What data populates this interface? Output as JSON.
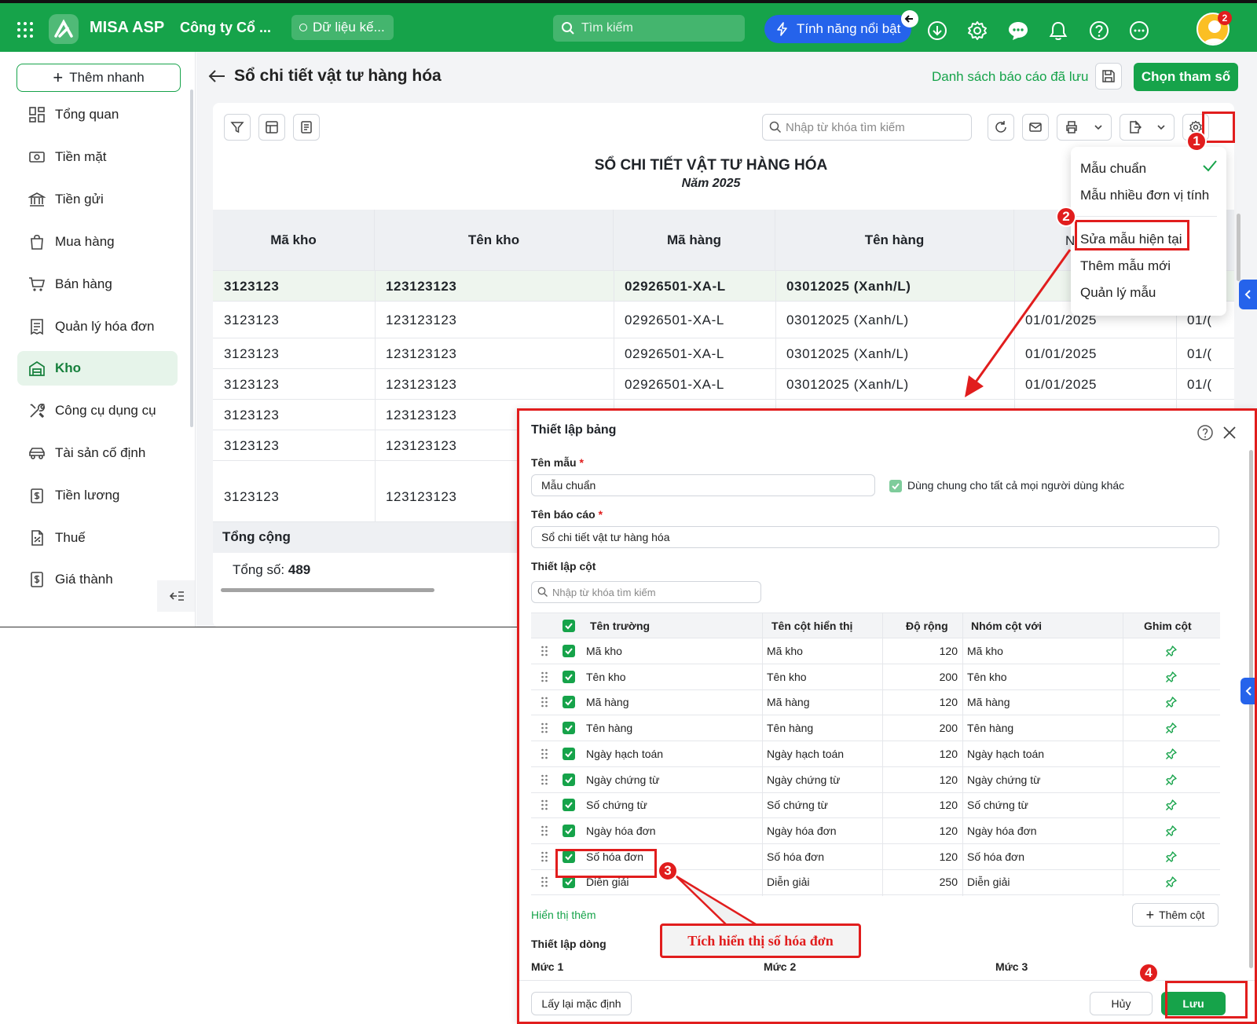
{
  "topbar": {
    "app_name": "MISA ASP",
    "company": "Công ty Cổ ...",
    "data_label": "Dữ liệu kế...",
    "search_placeholder": "Tìm kiếm",
    "feature_label": "Tính năng nổi bật",
    "notif_count": "2"
  },
  "sidebar": {
    "quick_add": "Thêm nhanh",
    "items": [
      {
        "label": "Tổng quan"
      },
      {
        "label": "Tiền mặt"
      },
      {
        "label": "Tiền gửi"
      },
      {
        "label": "Mua hàng"
      },
      {
        "label": "Bán hàng"
      },
      {
        "label": "Quản lý hóa đơn"
      },
      {
        "label": "Kho"
      },
      {
        "label": "Công cụ dụng cụ"
      },
      {
        "label": "Tài sản cố định"
      },
      {
        "label": "Tiền lương"
      },
      {
        "label": "Thuế"
      },
      {
        "label": "Giá thành"
      }
    ]
  },
  "page": {
    "title": "Sổ chi tiết vật tư hàng hóa",
    "saved_reports": "Danh sách báo cáo đã lưu",
    "choose_params": "Chọn tham số",
    "search_placeholder": "Nhập từ khóa tìm kiếm",
    "report_title": "SỔ CHI TIẾT VẬT TƯ HÀNG HÓA",
    "report_year": "Năm 2025"
  },
  "table": {
    "headers": [
      "Mã kho",
      "Tên kho",
      "Mã hàng",
      "Tên hàng"
    ],
    "group_row": [
      "3123123",
      "123123123",
      "02926501-XA-L",
      "03012025 (Xanh/L)"
    ],
    "rows": [
      [
        "3123123",
        "123123123",
        "02926501-XA-L",
        "03012025 (Xanh/L)",
        "01/01/2025",
        "01/("
      ],
      [
        "3123123",
        "123123123",
        "02926501-XA-L",
        "03012025 (Xanh/L)",
        "01/01/2025",
        "01/("
      ],
      [
        "3123123",
        "123123123",
        "02926501-XA-L",
        "03012025 (Xanh/L)",
        "01/01/2025",
        "01/("
      ],
      [
        "3123123",
        "123123123"
      ],
      [
        "3123123",
        "123123123"
      ],
      [
        "3123123",
        "123123123"
      ]
    ],
    "total_label": "Tổng cộng",
    "count_label": "Tổng số:",
    "count_value": "489"
  },
  "menu": {
    "items": [
      "Mẫu chuẩn",
      "Mẫu nhiều đơn vị tính",
      "Sửa mẫu hiện tại",
      "Thêm mẫu mới",
      "Quản lý mẫu"
    ],
    "peek": "N"
  },
  "dialog": {
    "title": "Thiết lập bảng",
    "template_label": "Tên mẫu",
    "template_value": "Mẫu chuẩn",
    "share_label": "Dùng chung cho tất cả mọi người dùng khác",
    "report_label": "Tên báo cáo",
    "report_value": "Sổ chi tiết vật tư hàng hóa",
    "columns_label": "Thiết lập cột",
    "columns_search": "Nhập từ khóa tìm kiếm",
    "grid_headers": [
      "Tên trường",
      "Tên cột hiển thị",
      "Độ rộng",
      "Nhóm cột với",
      "Ghim cột"
    ],
    "grid_rows": [
      {
        "field": "Mã kho",
        "display": "Mã kho",
        "width": "120",
        "group": "Mã kho"
      },
      {
        "field": "Tên kho",
        "display": "Tên kho",
        "width": "200",
        "group": "Tên kho"
      },
      {
        "field": "Mã hàng",
        "display": "Mã hàng",
        "width": "120",
        "group": "Mã hàng"
      },
      {
        "field": "Tên hàng",
        "display": "Tên hàng",
        "width": "200",
        "group": "Tên hàng"
      },
      {
        "field": "Ngày hạch toán",
        "display": "Ngày hạch toán",
        "width": "120",
        "group": "Ngày hạch toán"
      },
      {
        "field": "Ngày chứng từ",
        "display": "Ngày chứng từ",
        "width": "120",
        "group": "Ngày chứng từ"
      },
      {
        "field": "Số chứng từ",
        "display": "Số chứng từ",
        "width": "120",
        "group": "Số chứng từ"
      },
      {
        "field": "Ngày hóa đơn",
        "display": "Ngày hóa đơn",
        "width": "120",
        "group": "Ngày hóa đơn"
      },
      {
        "field": "Số hóa đơn",
        "display": "Số hóa đơn",
        "width": "120",
        "group": "Số hóa đơn"
      },
      {
        "field": "Diễn giải",
        "display": "Diễn giải",
        "width": "250",
        "group": "Diễn giải"
      }
    ],
    "show_more": "Hiển thị thêm",
    "add_column": "Thêm cột",
    "rows_label": "Thiết lập dòng",
    "levels": [
      "Mức 1",
      "Mức 2",
      "Mức 3"
    ],
    "reset": "Lấy lại mặc định",
    "cancel": "Hủy",
    "save": "Lưu"
  },
  "annotations": {
    "steps": [
      "1",
      "2",
      "3",
      "4"
    ],
    "callout": "Tích hiển thị số hóa đơn"
  },
  "colors": {
    "brand": "#16a34a",
    "highlight": "#e11d1d",
    "feature": "#2563eb"
  }
}
